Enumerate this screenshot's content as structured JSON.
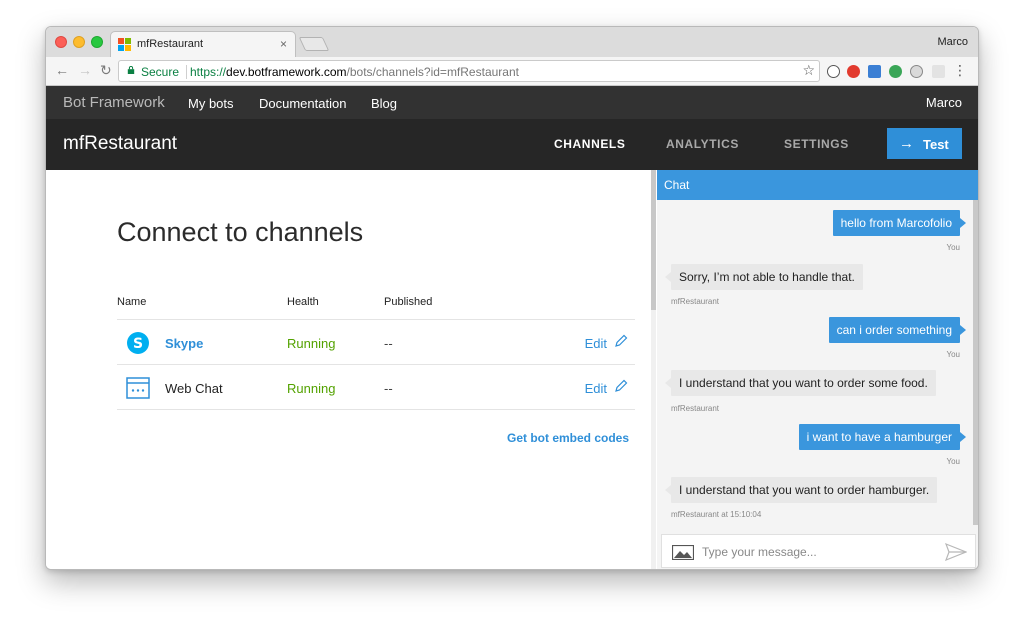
{
  "browser": {
    "tab_title": "mfRestaurant",
    "tab_close": "×",
    "profile": "Marco",
    "secure_label": "Secure",
    "url_protocol": "https://",
    "url_host": "dev.botframework.com",
    "url_path": "/bots/channels?id=mfRestaurant"
  },
  "site": {
    "brand": "Bot Framework",
    "nav": [
      "My bots",
      "Documentation",
      "Blog"
    ],
    "user": "Marco"
  },
  "bot": {
    "name": "mfRestaurant",
    "tabs": [
      "CHANNELS",
      "ANALYTICS",
      "SETTINGS"
    ],
    "active_tab": "CHANNELS",
    "test_label": "Test"
  },
  "channels": {
    "title": "Connect to channels",
    "columns": [
      "Name",
      "Health",
      "Published"
    ],
    "rows": [
      {
        "name": "Skype",
        "health": "Running",
        "published": "--",
        "edit": "Edit",
        "icon": "skype-icon"
      },
      {
        "name": "Web Chat",
        "health": "Running",
        "published": "--",
        "edit": "Edit",
        "icon": "webchat-icon"
      }
    ],
    "embed_link": "Get bot embed codes"
  },
  "chat": {
    "title": "Chat",
    "messages": [
      {
        "from": "user",
        "text": "hello from Marcofolio",
        "meta": "You"
      },
      {
        "from": "bot",
        "text": "Sorry, I’m not able to handle that.",
        "meta": "mfRestaurant"
      },
      {
        "from": "user",
        "text": "can i order something",
        "meta": "You"
      },
      {
        "from": "bot",
        "text": "I understand that you want to order some food.",
        "meta": "mfRestaurant"
      },
      {
        "from": "user",
        "text": "i want to have a hamburger",
        "meta": "You"
      },
      {
        "from": "bot",
        "text": "I understand that you want to order hamburger.",
        "meta": "mfRestaurant at 15:10:04"
      }
    ],
    "placeholder": "Type your message..."
  },
  "colors": {
    "accent": "#2f8fd8",
    "running": "#53a200",
    "chat_header": "#3a96dd"
  }
}
